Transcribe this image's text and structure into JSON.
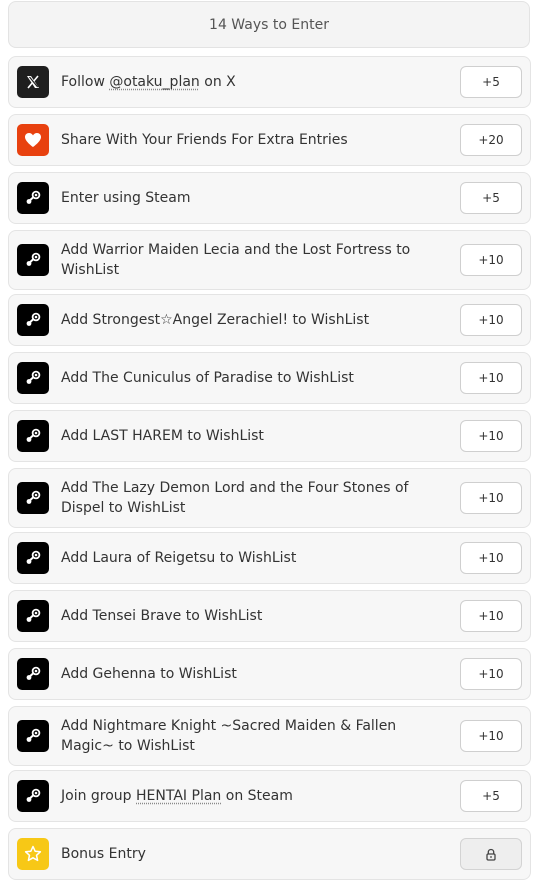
{
  "header": {
    "title": "14 Ways to Enter"
  },
  "colors": {
    "steam": "#000000",
    "x": "#1f1f1f",
    "share": "#e8410f",
    "bonus": "#f7c816"
  },
  "entries": [
    {
      "icon": "x-logo-icon",
      "parts": [
        {
          "t": "Follow "
        },
        {
          "t": "@otaku_plan",
          "u": true
        },
        {
          "t": " on X"
        }
      ],
      "points": "+5"
    },
    {
      "icon": "heart-icon",
      "parts": [
        {
          "t": "Share With Your Friends For Extra Entries"
        }
      ],
      "points": "+20"
    },
    {
      "icon": "steam-icon",
      "parts": [
        {
          "t": "Enter using Steam"
        }
      ],
      "points": "+5"
    },
    {
      "icon": "steam-icon",
      "parts": [
        {
          "t": "Add Warrior Maiden Lecia and the Lost Fortress to WishList"
        }
      ],
      "points": "+10"
    },
    {
      "icon": "steam-icon",
      "parts": [
        {
          "t": "Add Strongest☆Angel Zerachiel! to WishList"
        }
      ],
      "points": "+10"
    },
    {
      "icon": "steam-icon",
      "parts": [
        {
          "t": "Add The Cuniculus of Paradise to WishList"
        }
      ],
      "points": "+10"
    },
    {
      "icon": "steam-icon",
      "parts": [
        {
          "t": "Add LAST HAREM to WishList"
        }
      ],
      "points": "+10"
    },
    {
      "icon": "steam-icon",
      "parts": [
        {
          "t": "Add The Lazy Demon Lord and the Four Stones of Dispel to WishList"
        }
      ],
      "points": "+10"
    },
    {
      "icon": "steam-icon",
      "parts": [
        {
          "t": "Add Laura of Reigetsu to WishList"
        }
      ],
      "points": "+10"
    },
    {
      "icon": "steam-icon",
      "parts": [
        {
          "t": "Add Tensei Brave to WishList"
        }
      ],
      "points": "+10"
    },
    {
      "icon": "steam-icon",
      "parts": [
        {
          "t": "Add Gehenna to WishList"
        }
      ],
      "points": "+10"
    },
    {
      "icon": "steam-icon",
      "parts": [
        {
          "t": "Add Nightmare Knight ~Sacred Maiden & Fallen Magic~ to WishList"
        }
      ],
      "points": "+10"
    },
    {
      "icon": "steam-icon",
      "parts": [
        {
          "t": "Join group "
        },
        {
          "t": "HENTAI Plan",
          "u": true
        },
        {
          "t": " on Steam"
        }
      ],
      "points": "+5"
    },
    {
      "icon": "star-icon",
      "parts": [
        {
          "t": "Bonus Entry"
        }
      ],
      "points": null,
      "locked": true
    }
  ]
}
